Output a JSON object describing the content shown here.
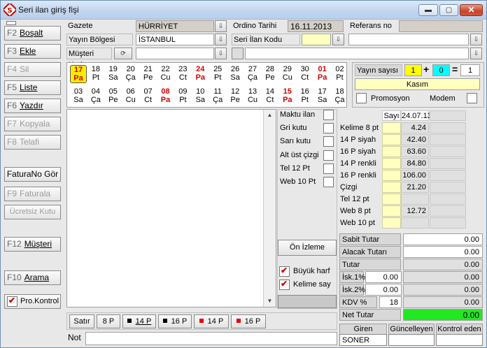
{
  "window": {
    "title": "Seri ilan giriş fişi",
    "min": "▬",
    "max": "▢",
    "close": "✕"
  },
  "sidebar": {
    "boşalt": {
      "key": "F2",
      "label": "Boşalt"
    },
    "ekle": {
      "key": "F3",
      "label": "Ekle"
    },
    "sil": {
      "key": "F4",
      "label": "Sil"
    },
    "liste": {
      "key": "F5",
      "label": "Liste"
    },
    "yazdir": {
      "key": "F6",
      "label": "Yazdır"
    },
    "kopyala": {
      "key": "F7",
      "label": "Kopyala"
    },
    "telafi": {
      "key": "F8",
      "label": "Telafi"
    },
    "faturano": {
      "label": "FaturaNo Gör"
    },
    "faturala": {
      "key": "F9",
      "label": "Faturala"
    },
    "ucretsiz": {
      "label": "Ücretsiz Kutu"
    },
    "musteri": {
      "key": "F12",
      "label": "Müşteri"
    },
    "arama": {
      "key": "F10",
      "label": "Arama"
    },
    "prokontrol": {
      "label": "Pro.Kontrol"
    }
  },
  "form": {
    "gazete_label": "Gazete",
    "gazete_value": "HÜRRİYET",
    "ordino_label": "Ordino Tarihi",
    "ordino_value": "16.11.2013",
    "referans_label": "Referans no",
    "referans_value": "",
    "bolge_label": "Yayın Bölgesi",
    "bolge_value": "İSTANBUL",
    "seri_label": "Seri İlan Kodu",
    "seri_value": "",
    "musteri_label": "Müşteri Kodu",
    "musteri_value": ""
  },
  "calendar": {
    "row1": [
      {
        "d": "17",
        "w": "Pa",
        "t": "sel"
      },
      {
        "d": "18",
        "w": "Pt",
        "t": ""
      },
      {
        "d": "19",
        "w": "Sa",
        "t": ""
      },
      {
        "d": "20",
        "w": "Ça",
        "t": ""
      },
      {
        "d": "21",
        "w": "Pe",
        "t": ""
      },
      {
        "d": "22",
        "w": "Cu",
        "t": ""
      },
      {
        "d": "23",
        "w": "Ct",
        "t": ""
      },
      {
        "d": "24",
        "w": "Pa",
        "t": "red"
      },
      {
        "d": "25",
        "w": "Pt",
        "t": ""
      },
      {
        "d": "26",
        "w": "Sa",
        "t": ""
      },
      {
        "d": "27",
        "w": "Ça",
        "t": ""
      },
      {
        "d": "28",
        "w": "Pe",
        "t": ""
      },
      {
        "d": "29",
        "w": "Cu",
        "t": ""
      },
      {
        "d": "30",
        "w": "Ct",
        "t": ""
      },
      {
        "d": "01",
        "w": "Pa",
        "t": "red"
      },
      {
        "d": "02",
        "w": "Pt",
        "t": ""
      }
    ],
    "row2": [
      {
        "d": "03",
        "w": "Sa",
        "t": ""
      },
      {
        "d": "04",
        "w": "Ça",
        "t": ""
      },
      {
        "d": "05",
        "w": "Pe",
        "t": ""
      },
      {
        "d": "06",
        "w": "Cu",
        "t": ""
      },
      {
        "d": "07",
        "w": "Ct",
        "t": ""
      },
      {
        "d": "08",
        "w": "Pa",
        "t": "red"
      },
      {
        "d": "09",
        "w": "Pt",
        "t": ""
      },
      {
        "d": "10",
        "w": "Sa",
        "t": ""
      },
      {
        "d": "11",
        "w": "Ça",
        "t": ""
      },
      {
        "d": "12",
        "w": "Pe",
        "t": ""
      },
      {
        "d": "13",
        "w": "Cu",
        "t": ""
      },
      {
        "d": "14",
        "w": "Ct",
        "t": ""
      },
      {
        "d": "15",
        "w": "Pa",
        "t": "red"
      },
      {
        "d": "16",
        "w": "Pt",
        "t": ""
      },
      {
        "d": "17",
        "w": "Sa",
        "t": ""
      },
      {
        "d": "18",
        "w": "Ça",
        "t": ""
      }
    ]
  },
  "yayin": {
    "label": "Yayın sayısı",
    "a": "1",
    "plus": "+",
    "b": "0",
    "eq": "=",
    "total": "1",
    "month": "Kasım",
    "promosyon": "Promosyon",
    "modem": "Modem"
  },
  "options": {
    "items": [
      "Maktu ilan",
      "Gri kutu",
      "Sarı kutu",
      "Alt üst çizgi",
      "Tel 12 Pt",
      "Web 10 Pt"
    ],
    "onizleme": "Ön İzleme",
    "buyukharf": "Büyük harf",
    "kelimesay": "Kelime say"
  },
  "sizes": {
    "satir": "Satır",
    "b8p": "8 P",
    "b14p": "14 P",
    "b16p": "16 P",
    "b14pr": "14 P",
    "b16pr": "16 P",
    "not_label": "Not"
  },
  "prices": {
    "sayi_header": "Sayı",
    "date_header": "24.07.13",
    "rows": [
      {
        "label": "Kelime 8 pt",
        "value": "4.24"
      },
      {
        "label": "14 P siyah",
        "value": "42.40"
      },
      {
        "label": "16 P siyah",
        "value": "63.60"
      },
      {
        "label": "14 P renkli",
        "value": "84.80"
      },
      {
        "label": "16 P renkli",
        "value": "106.00"
      },
      {
        "label": "Çizgi",
        "value": "21.20"
      },
      {
        "label": "Tel 12 pt",
        "value": ""
      },
      {
        "label": "Web 8 pt",
        "value": "12.72"
      },
      {
        "label": "Web 10 pt",
        "value": ""
      }
    ]
  },
  "totals": {
    "sabit_label": "Sabit Tutar",
    "sabit": "0.00",
    "alacak_label": "Alacak Tutarı",
    "alacak": "0.00",
    "tutar_label": "Tutar",
    "tutar": "0.00",
    "isk1_label": "İsk.1%",
    "isk1_pct": "0.00",
    "isk1": "0.00",
    "isk2_label": "İsk.2%",
    "isk2_pct": "0.00",
    "isk2": "0.00",
    "kdv_label": "KDV %",
    "kdv_pct": "18",
    "kdv": "0.00",
    "net_label": "Net Tutar",
    "net": "0.00"
  },
  "footer": {
    "giren": "Giren",
    "giren_value": "SONER",
    "guncelleyen": "Güncelleyen",
    "guncelleyen_value": "",
    "kontrol": "Kontrol eden",
    "kontrol_value": ""
  },
  "colors": {
    "net_green": "#22e822",
    "yellow_field": "#ffffc0",
    "highlight": "#ffee00",
    "red": "#d40000",
    "cyan": "#00ffff"
  }
}
